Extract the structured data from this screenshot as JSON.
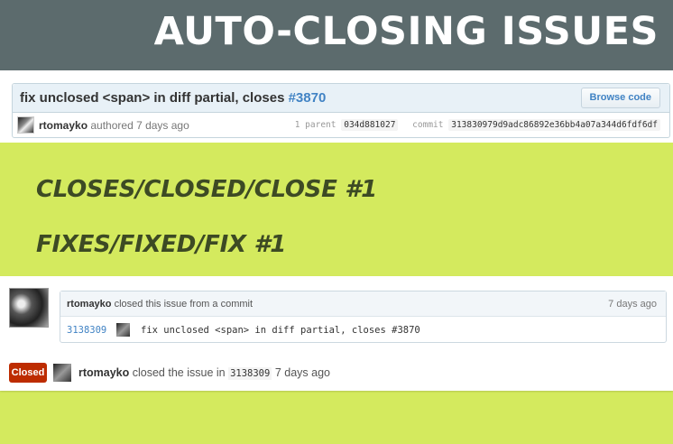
{
  "header": {
    "title": "AUTO-CLOSING ISSUES"
  },
  "commit": {
    "title_prefix": "fix unclosed <span> in diff partial, closes ",
    "issue_ref": "#3870",
    "browse_label": "Browse code",
    "author": "rtomayko",
    "authored_text": " authored 7 days ago",
    "parent_label": "1 parent",
    "parent_sha": "034d881027",
    "commit_label": "commit",
    "commit_sha": "313830979d9adc86892e36bb4a07a344d6fdf6df"
  },
  "keywords": {
    "line1": "CLOSES/CLOSED/CLOSE #1",
    "line2": "FIXES/FIXED/FIX #1"
  },
  "event": {
    "author": "rtomayko",
    "action": " closed this issue from a commit",
    "time": "7 days ago",
    "sha": "3138309",
    "message": "fix unclosed <span> in diff partial, closes #3870"
  },
  "closed": {
    "badge": "Closed",
    "author": "rtomayko",
    "text_before": " closed the issue in ",
    "sha": "3138309",
    "text_after": " 7 days ago"
  },
  "colors": {
    "background": "#d4ea5e",
    "header": "#5c6b6d",
    "keyword_text": "#3d4a24",
    "link": "#4183c4",
    "closed_badge": "#bd2c00"
  }
}
